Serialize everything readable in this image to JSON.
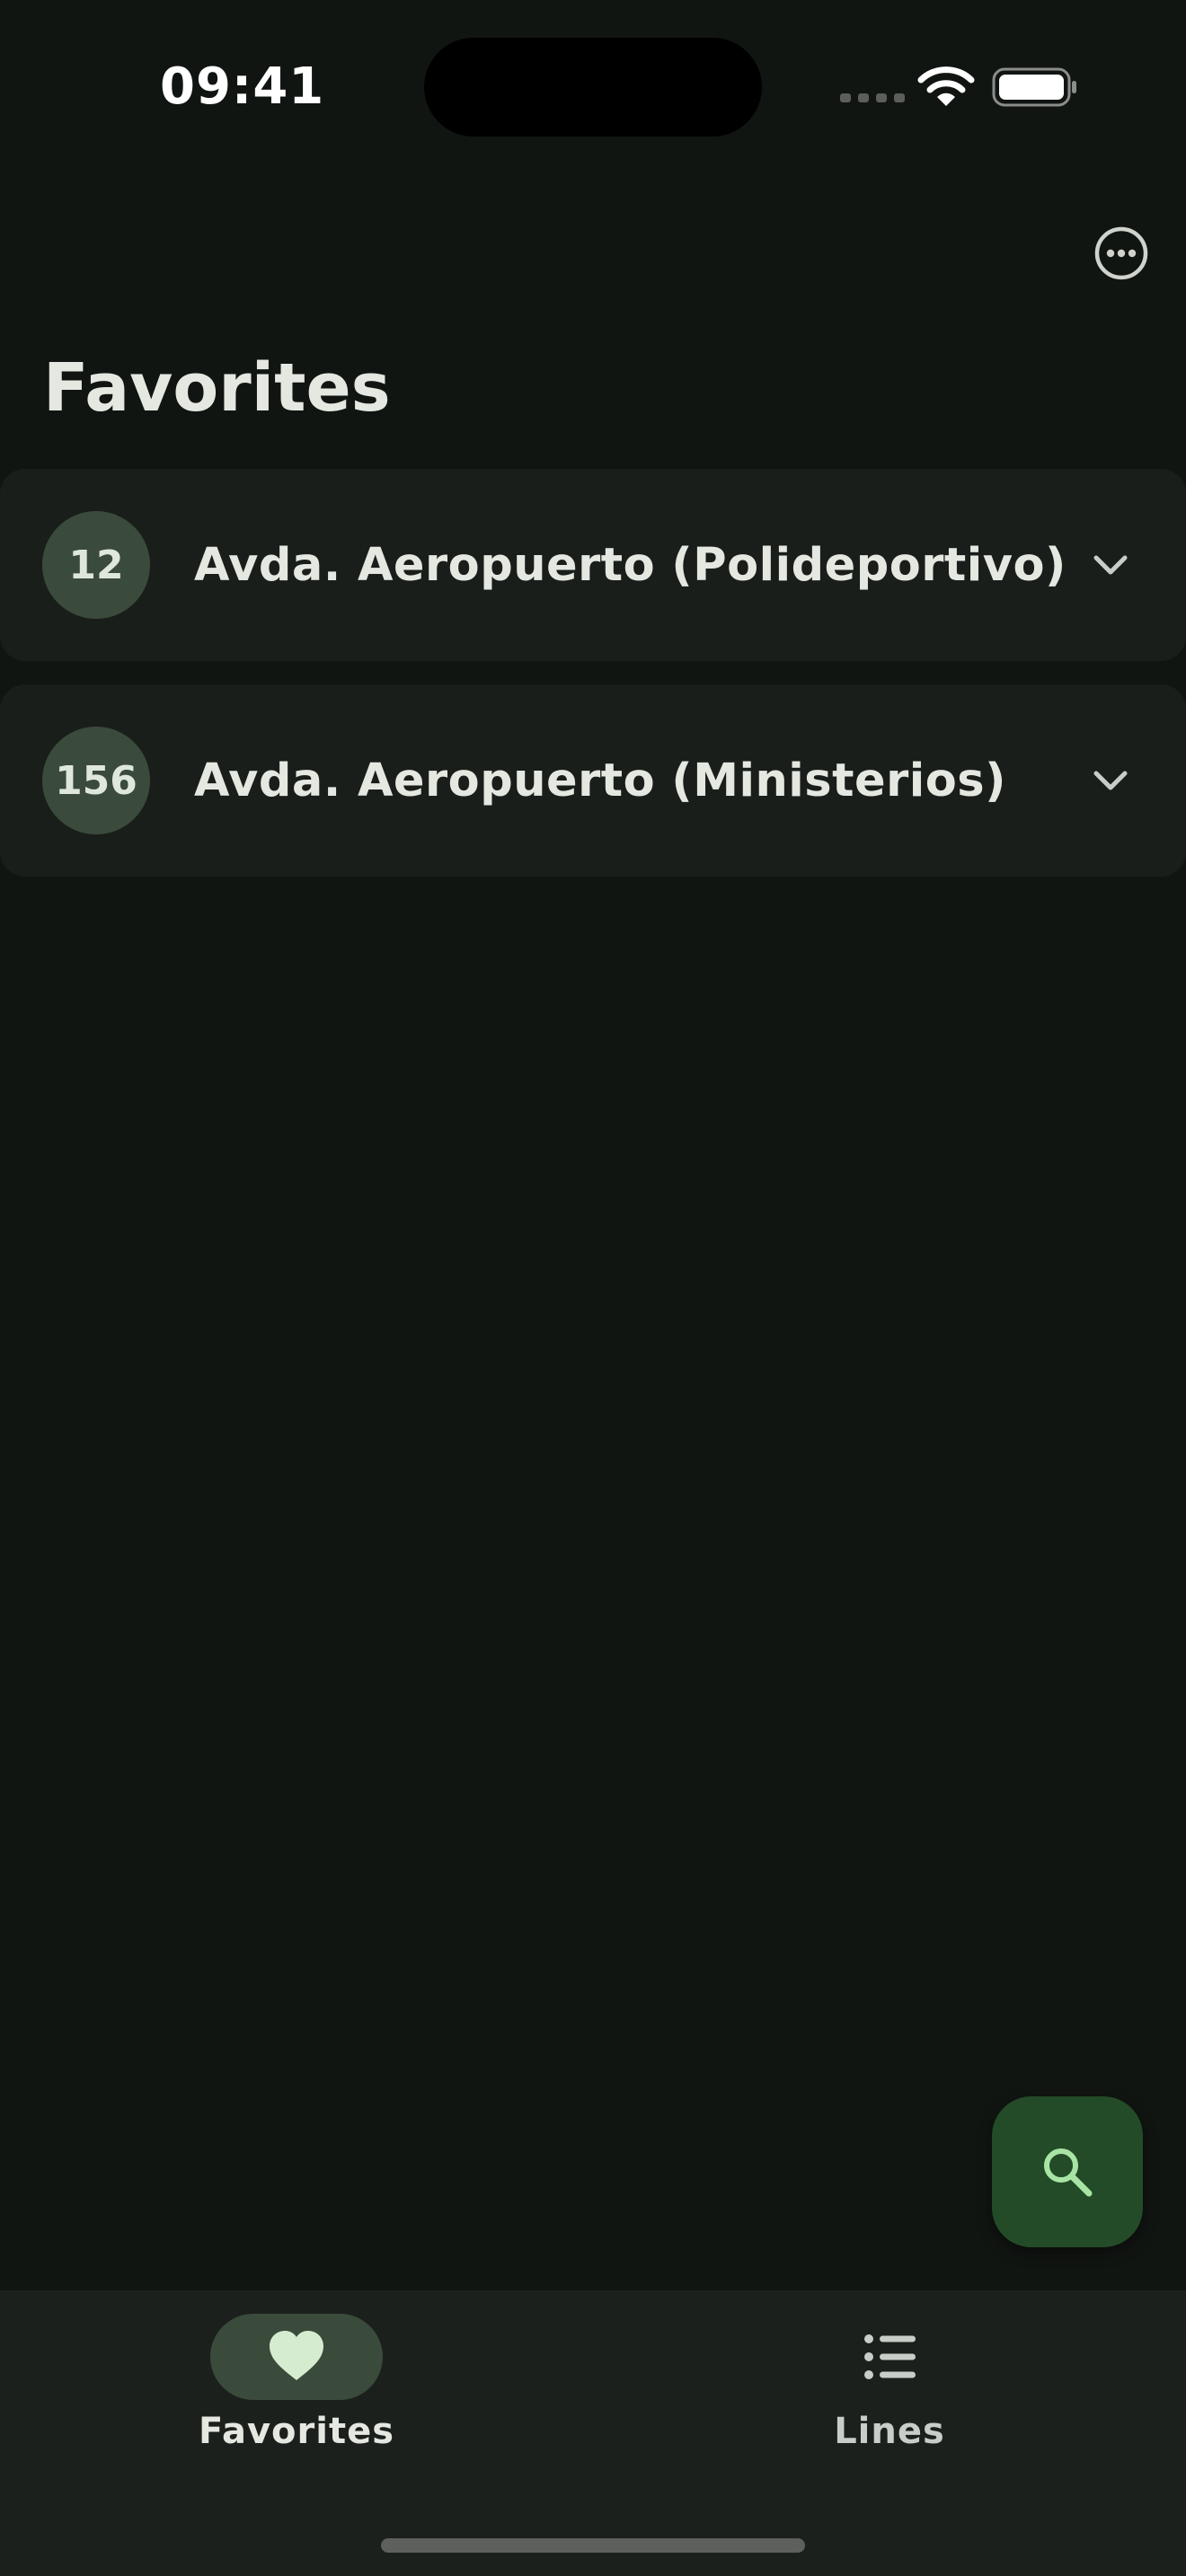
{
  "status_bar": {
    "time": "09:41"
  },
  "header": {
    "title": "Favorites",
    "more_icon": "more-horizontal-circle-icon"
  },
  "favorites": [
    {
      "number": "12",
      "name": "Avda. Aeropuerto (Polideportivo)",
      "icon": "chevron-down-icon"
    },
    {
      "number": "156",
      "name": "Avda. Aeropuerto (Ministerios)",
      "icon": "chevron-down-icon"
    }
  ],
  "fab": {
    "icon": "search-icon"
  },
  "bottom_nav": {
    "items": [
      {
        "label": "Favorites",
        "icon": "heart-icon",
        "selected": true
      },
      {
        "label": "Lines",
        "icon": "list-icon",
        "selected": false
      }
    ]
  },
  "colors": {
    "background": "#111512",
    "card": "#1a1e1b",
    "badge": "#3a4a3b",
    "fab": "#234b27",
    "accent": "#a8e4a4",
    "nav_bar": "#1c201d"
  }
}
